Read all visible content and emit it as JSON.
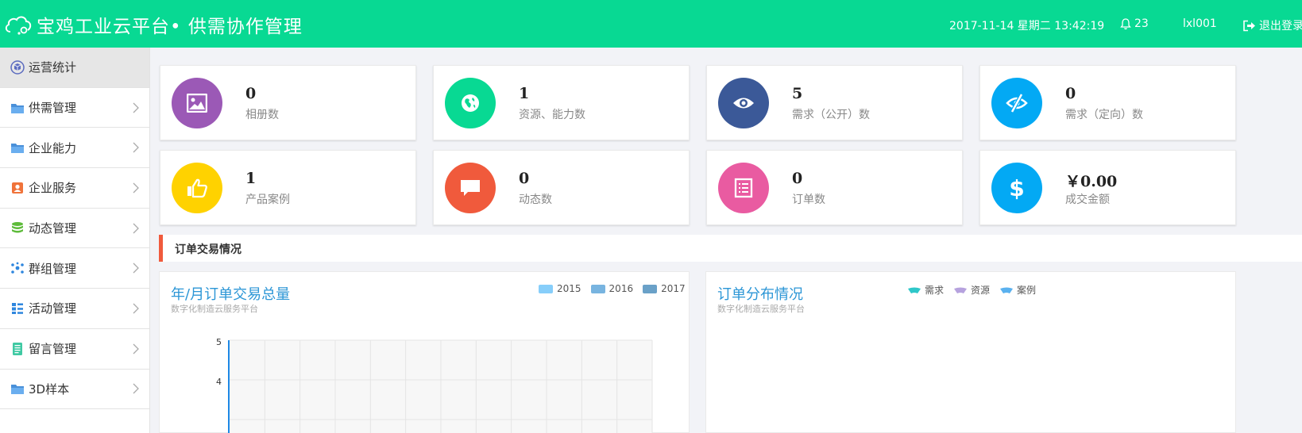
{
  "header": {
    "app_title": "宝鸡工业云平台• 供需协作管理",
    "datetime": "2017-11-14 星期二 13:42:19",
    "notifications": "23",
    "username": "lxl001",
    "logout": "退出登录"
  },
  "sidebar": {
    "items": [
      {
        "label": "运营统计",
        "icon": "cube-icon",
        "active": true
      },
      {
        "label": "供需管理",
        "icon": "folder-icon"
      },
      {
        "label": "企业能力",
        "icon": "folder-icon"
      },
      {
        "label": "企业服务",
        "icon": "person-card-icon"
      },
      {
        "label": "动态管理",
        "icon": "database-icon"
      },
      {
        "label": "群组管理",
        "icon": "group-dots-icon"
      },
      {
        "label": "活动管理",
        "icon": "grid-list-icon"
      },
      {
        "label": "留言管理",
        "icon": "notebook-icon"
      },
      {
        "label": "3D样本",
        "icon": "folder-icon"
      }
    ]
  },
  "stats": [
    {
      "value": "0",
      "label": "相册数",
      "color": "#9b59b6",
      "icon": "image-icon"
    },
    {
      "value": "1",
      "label": "资源、能力数",
      "color": "#08d993",
      "icon": "globe-icon"
    },
    {
      "value": "5",
      "label": "需求（公开）数",
      "color": "#3b5998",
      "icon": "eye-icon"
    },
    {
      "value": "0",
      "label": "需求（定向）数",
      "color": "#03a9f4",
      "icon": "eye-slash-icon"
    },
    {
      "value": "1",
      "label": "产品案例",
      "color": "#ffd200",
      "icon": "thumbs-up-icon"
    },
    {
      "value": "0",
      "label": "动态数",
      "color": "#f05a3c",
      "icon": "comment-icon"
    },
    {
      "value": "0",
      "label": "订单数",
      "color": "#e95ba1",
      "icon": "list-doc-icon"
    },
    {
      "value": "￥0.00",
      "label": "成交金额",
      "color": "#03a9f4",
      "icon": "dollar-icon"
    }
  ],
  "section": {
    "title": "订单交易情况"
  },
  "panel_left": {
    "title": "年/月订单交易总量",
    "subtitle": "数字化制造云服务平台",
    "legend": [
      {
        "name": "2015",
        "color": "#87cefa"
      },
      {
        "name": "2016",
        "color": "#78b4e0"
      },
      {
        "name": "2017",
        "color": "#6aa1c8"
      }
    ]
  },
  "panel_right": {
    "title": "订单分布情况",
    "subtitle": "数字化制造云服务平台",
    "legend": [
      {
        "name": "需求",
        "color": "#2ec7c9"
      },
      {
        "name": "资源",
        "color": "#b6a2de"
      },
      {
        "name": "案例",
        "color": "#5ab1ef"
      }
    ]
  },
  "chart_data": {
    "type": "bar",
    "title": "年/月订单交易总量",
    "series": [
      {
        "name": "2015",
        "values": []
      },
      {
        "name": "2016",
        "values": []
      },
      {
        "name": "2017",
        "values": []
      }
    ],
    "y_ticks": [
      "5",
      "4"
    ],
    "grid": true,
    "legend": "top-right"
  }
}
